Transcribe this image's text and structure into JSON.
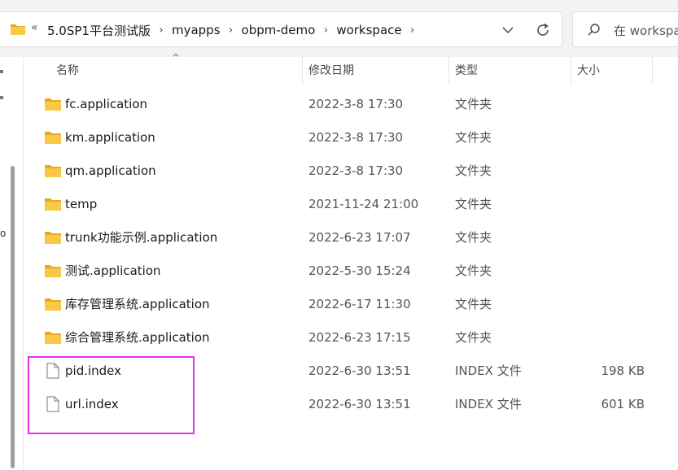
{
  "address": {
    "overflow_label": "«",
    "crumbs": [
      "5.0SP1平台测试版",
      "myapps",
      "obpm-demo",
      "workspace"
    ]
  },
  "search": {
    "placeholder": "在 workspace"
  },
  "nav": {
    "cut_text": "o"
  },
  "columns": {
    "name": "名称",
    "date": "修改日期",
    "type": "类型",
    "size": "大小"
  },
  "files": [
    {
      "icon": "folder-icon",
      "name": "fc.application",
      "date": "2022-3-8 17:30",
      "type": "文件夹",
      "size": ""
    },
    {
      "icon": "folder-icon",
      "name": "km.application",
      "date": "2022-3-8 17:30",
      "type": "文件夹",
      "size": ""
    },
    {
      "icon": "folder-icon",
      "name": "qm.application",
      "date": "2022-3-8 17:30",
      "type": "文件夹",
      "size": ""
    },
    {
      "icon": "folder-icon",
      "name": "temp",
      "date": "2021-11-24 21:00",
      "type": "文件夹",
      "size": ""
    },
    {
      "icon": "folder-icon",
      "name": "trunk功能示例.application",
      "date": "2022-6-23 17:07",
      "type": "文件夹",
      "size": ""
    },
    {
      "icon": "folder-icon",
      "name": "测试.application",
      "date": "2022-5-30 15:24",
      "type": "文件夹",
      "size": ""
    },
    {
      "icon": "folder-icon",
      "name": "库存管理系统.application",
      "date": "2022-6-17 11:30",
      "type": "文件夹",
      "size": ""
    },
    {
      "icon": "folder-icon",
      "name": "综合管理系统.application",
      "date": "2022-6-23 17:15",
      "type": "文件夹",
      "size": ""
    },
    {
      "icon": "file-icon",
      "name": "pid.index",
      "date": "2022-6-30 13:51",
      "type": "INDEX 文件",
      "size": "198 KB"
    },
    {
      "icon": "file-icon",
      "name": "url.index",
      "date": "2022-6-30 13:51",
      "type": "INDEX 文件",
      "size": "601 KB"
    }
  ],
  "colors": {
    "highlight": "#e62ee6",
    "folder": "#f8c947",
    "folder_dark": "#e8aa1e"
  }
}
